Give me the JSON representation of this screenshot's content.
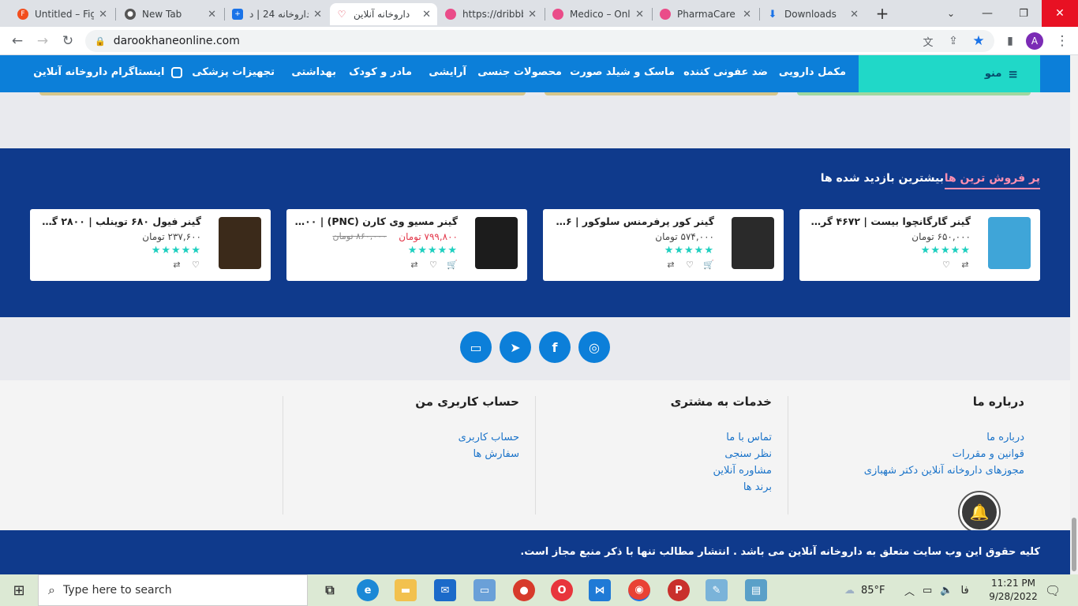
{
  "browser": {
    "tabs": [
      {
        "title": "Untitled – Fig",
        "icon": "figma-icon",
        "color": "#f24e1e"
      },
      {
        "title": "New Tab",
        "icon": "chrome-icon",
        "color": "#555555"
      },
      {
        "title": "داروخانه 24 | د",
        "icon": "pharmacy24-icon",
        "color": "#1a73e8"
      },
      {
        "title": "داروخانه آنلاین",
        "icon": "heart-pulse-icon",
        "color": "#e3374a",
        "active": true
      },
      {
        "title": "https://dribbb",
        "icon": "dribbble-icon",
        "color": "#ea4c89"
      },
      {
        "title": "Medico – Onl",
        "icon": "dribbble-icon",
        "color": "#ea4c89"
      },
      {
        "title": "PharmaCare -",
        "icon": "dribbble-icon",
        "color": "#ea4c89"
      },
      {
        "title": "Downloads",
        "icon": "download-icon",
        "color": "#1a73e8"
      }
    ],
    "url": "darookhaneonline.com",
    "profile_initial": "A"
  },
  "menu": {
    "toggle_label": "منو",
    "items": [
      "مکمل دارویی",
      "ضد عفونی کننده",
      "ماسک و شیلد صورت",
      "محصولات جنسی",
      "آرایشی",
      "مادر و کودک",
      "بهداشتی",
      "تجهیزات پزشکی",
      "اینستاگرام داروخانه آنلاین"
    ]
  },
  "products": {
    "tab_bestsellers": "پر فروش ترین ها",
    "tab_most_viewed": "بیشترین بازدید شده ها",
    "items": [
      {
        "name": "گینر گارگانچوا بیست | ۴۶۷۲ گرم | اف...",
        "price": "۶۵۰,۰۰۰ تومان",
        "old_price": "",
        "rating": 5,
        "thumb_color": "#3fa5d8"
      },
      {
        "name": "گینر کور پرفرمنس سلوکور | ۲۴۳۶ گر...",
        "price": "۵۷۴,۰۰۰ تومان",
        "old_price": "",
        "rating": 5,
        "thumb_color": "#2a2a2a"
      },
      {
        "name": "گینر مسیو وی کارن (PNC) | ۱۰۰۰ گر...",
        "price": "۷۹۹,۸۰۰ تومان",
        "old_price": "۸۶۰,۰۰۰ تومان",
        "rating": 5,
        "thumb_color": "#1c1c1c"
      },
      {
        "name": "گینر فیول ۶۸۰ توینلب | ۲۸۰۰ گرم | ...",
        "price": "۲۳۷,۶۰۰ تومان",
        "old_price": "",
        "rating": 5,
        "thumb_color": "#3b2a1a"
      }
    ]
  },
  "social": [
    "instagram-icon",
    "facebook-icon",
    "telegram-icon",
    "aparat-icon"
  ],
  "footer": {
    "about": {
      "title": "درباره ما",
      "links": [
        "درباره ما",
        "قوانین و مقررات",
        "مجوزهای داروخانه آنلاین دکتر شهبازی"
      ]
    },
    "services": {
      "title": "خدمات به مشتری",
      "links": [
        "تماس با ما",
        "نظر سنجی",
        "مشاوره آنلاین",
        "برند ها"
      ]
    },
    "account": {
      "title": "حساب کاربری من",
      "links": [
        "حساب کاربری",
        "سفارش ها"
      ]
    },
    "copyright": "کلیه حقوق این وب سایت متعلق به داروخانه آنلاین می باشد . انتشار مطالب تنها با ذکر منبع مجاز است."
  },
  "taskbar": {
    "search_placeholder": "Type here to search",
    "weather": "85°F",
    "lang": "فا",
    "time": "11:21 PM",
    "date": "9/28/2022"
  }
}
